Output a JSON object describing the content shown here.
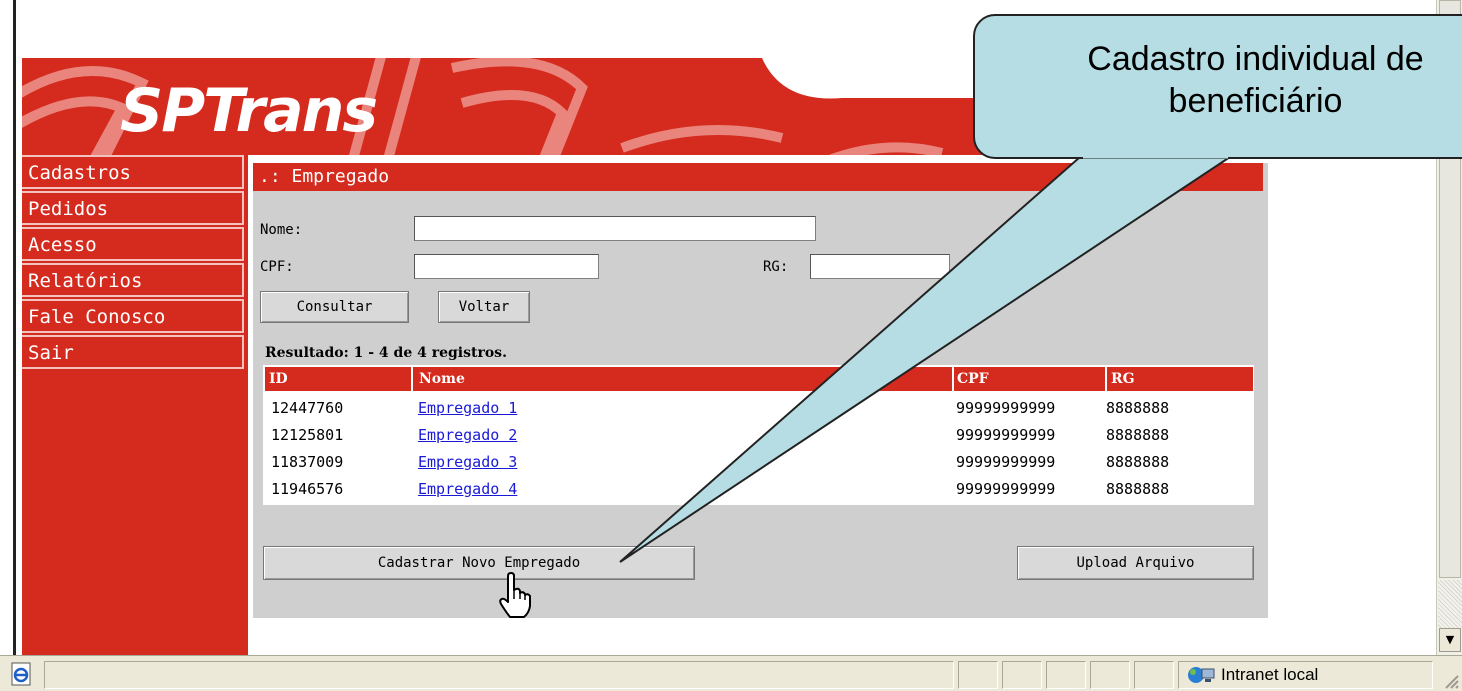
{
  "brand": {
    "logo_text": "SPTrans",
    "primary_color": "#d52a1e",
    "panel_color": "#cfcfcf"
  },
  "sidebar": {
    "items": [
      {
        "label": "Cadastros"
      },
      {
        "label": "Pedidos"
      },
      {
        "label": "Acesso"
      },
      {
        "label": "Relatórios"
      },
      {
        "label": "Fale Conosco"
      },
      {
        "label": "Sair"
      }
    ]
  },
  "panel": {
    "title": ".: Empregado",
    "form": {
      "nome_label": "Nome:",
      "nome_value": "",
      "cpf_label": "CPF:",
      "cpf_value": "",
      "rg_label": "RG:",
      "rg_value": ""
    },
    "buttons": {
      "consultar": "Consultar",
      "voltar": "Voltar",
      "cadastrar": "Cadastrar Novo Empregado",
      "upload": "Upload Arquivo"
    },
    "result_summary": "Resultado: 1 - 4 de 4 registros.",
    "table": {
      "columns": [
        "ID",
        "Nome",
        "CPF",
        "RG"
      ],
      "rows": [
        {
          "id": "12447760",
          "nome": "Empregado 1",
          "cpf": "99999999999",
          "rg": "8888888"
        },
        {
          "id": "12125801",
          "nome": "Empregado 2",
          "cpf": "99999999999",
          "rg": "8888888"
        },
        {
          "id": "11837009",
          "nome": "Empregado 3",
          "cpf": "99999999999",
          "rg": "8888888"
        },
        {
          "id": "11946576",
          "nome": "Empregado 4",
          "cpf": "99999999999",
          "rg": "8888888"
        }
      ]
    }
  },
  "callout": {
    "line1": "Cadastro individual de",
    "line2": "beneficiário"
  },
  "statusbar": {
    "zone": "Intranet local"
  }
}
